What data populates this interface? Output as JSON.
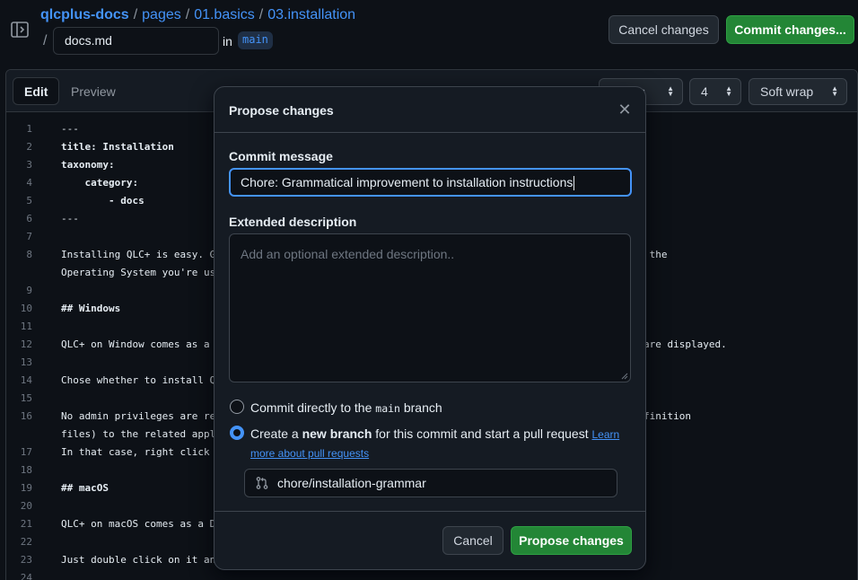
{
  "header": {
    "breadcrumb": {
      "repo": "qlcplus-docs",
      "sep": "/",
      "parts": [
        "pages",
        "01.basics",
        "03.installation"
      ]
    },
    "slash": "/",
    "filename": "docs.md",
    "in_label": "in",
    "branch": "main",
    "cancel_label": "Cancel changes",
    "commit_label": "Commit changes..."
  },
  "editor": {
    "tabs": {
      "edit": "Edit",
      "preview": "Preview"
    },
    "indent_mode_visible": "s",
    "indent_size": "4",
    "wrap_mode": "Soft wrap",
    "lines": [
      {
        "n": "1",
        "t": "---"
      },
      {
        "n": "2",
        "t": "title: Installation"
      },
      {
        "n": "3",
        "t": "taxonomy:"
      },
      {
        "n": "4",
        "t": "    category:"
      },
      {
        "n": "5",
        "t": "        - docs"
      },
      {
        "n": "6",
        "t": "---"
      },
      {
        "n": "7",
        "t": ""
      },
      {
        "n": "8",
        "t": "Installing QLC+ is easy. G                                                    rsion you prefer for the"
      },
      {
        "n": "",
        "t": "Operating System you're us"
      },
      {
        "n": "9",
        "t": ""
      },
      {
        "n": "10",
        "t": "## Windows"
      },
      {
        "n": "11",
        "t": ""
      },
      {
        "n": "12",
        "t": "QLC+ on Window comes as a                                                     e instructions that are displayed."
      },
      {
        "n": "13",
        "t": ""
      },
      {
        "n": "14",
        "t": "Chose whether to install Q                                                    Files."
      },
      {
        "n": "15",
        "t": ""
      },
      {
        "n": "16",
        "t": "No admin privileges are re                                                    and .qxf (Fixture definition"
      },
      {
        "n": "",
        "t": "files) to the related appl"
      },
      {
        "n": "17",
        "t": "In that case, right click"
      },
      {
        "n": "18",
        "t": ""
      },
      {
        "n": "19",
        "t": "## macOS"
      },
      {
        "n": "20",
        "t": ""
      },
      {
        "n": "21",
        "t": "QLC+ on macOS comes as a D"
      },
      {
        "n": "22",
        "t": ""
      },
      {
        "n": "23",
        "t": "Just double click on it an                                                    tion folder."
      },
      {
        "n": "24",
        "t": ""
      }
    ]
  },
  "dialog": {
    "title": "Propose changes",
    "close_icon": "x-icon",
    "commit_message_label": "Commit message",
    "commit_message_value": "Chore: Grammatical improvement to installation instructions",
    "extended_label": "Extended description",
    "extended_placeholder": "Add an optional extended description..",
    "option_direct_pre": "Commit directly to the ",
    "option_direct_branch": "main",
    "option_direct_post": " branch",
    "option_new_pre": "Create a ",
    "option_new_bold": "new branch",
    "option_new_post": " for this commit and start a pull request ",
    "learn_link_1": "Learn",
    "learn_link_2": "more about pull requests",
    "new_branch_name": "chore/installation-grammar",
    "cancel_label": "Cancel",
    "propose_label": "Propose changes"
  }
}
